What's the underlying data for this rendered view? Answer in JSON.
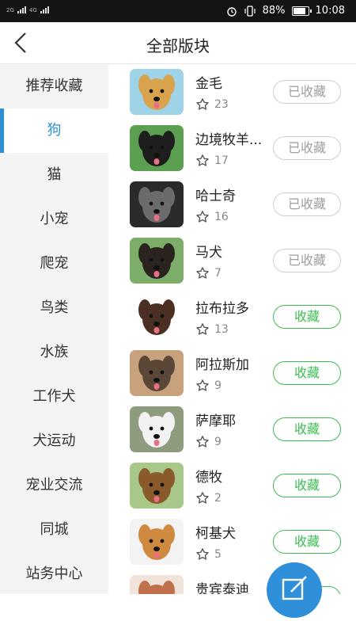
{
  "status_bar": {
    "signal_left": "2G",
    "signal_right": "4G",
    "battery": "88%",
    "time": "10:08"
  },
  "header": {
    "title": "全部版块",
    "back_icon": "chevron-left-icon"
  },
  "sidebar": {
    "items": [
      {
        "label": "推荐收藏",
        "active": false
      },
      {
        "label": "狗",
        "active": true
      },
      {
        "label": "猫",
        "active": false
      },
      {
        "label": "小宠",
        "active": false
      },
      {
        "label": "爬宠",
        "active": false
      },
      {
        "label": "鸟类",
        "active": false
      },
      {
        "label": "水族",
        "active": false
      },
      {
        "label": "工作犬",
        "active": false
      },
      {
        "label": "犬运动",
        "active": false
      },
      {
        "label": "宠业交流",
        "active": false
      },
      {
        "label": "同城",
        "active": false
      },
      {
        "label": "站务中心",
        "active": false
      }
    ]
  },
  "boards": [
    {
      "name": "金毛",
      "count": "23",
      "button": "已收藏",
      "collected": true,
      "fur": "#d9a24c",
      "bg": "#9fd3e8"
    },
    {
      "name": "边境牧羊...",
      "count": "17",
      "button": "已收藏",
      "collected": true,
      "fur": "#1e1e1e",
      "bg": "#5aa050"
    },
    {
      "name": "哈士奇",
      "count": "16",
      "button": "已收藏",
      "collected": true,
      "fur": "#6b6b6b",
      "bg": "#2a2a2a"
    },
    {
      "name": "马犬",
      "count": "7",
      "button": "已收藏",
      "collected": true,
      "fur": "#2b241e",
      "bg": "#7cae6a"
    },
    {
      "name": "拉布拉多",
      "count": "13",
      "button": "收藏",
      "collected": false,
      "fur": "#4a2f22",
      "bg": "#ffffff"
    },
    {
      "name": "阿拉斯加",
      "count": "9",
      "button": "收藏",
      "collected": false,
      "fur": "#5a4738",
      "bg": "#c8a27c"
    },
    {
      "name": "萨摩耶",
      "count": "9",
      "button": "收藏",
      "collected": false,
      "fur": "#f2f2f2",
      "bg": "#8f9b7d"
    },
    {
      "name": "德牧",
      "count": "2",
      "button": "收藏",
      "collected": false,
      "fur": "#8a5a2b",
      "bg": "#a8c88a"
    },
    {
      "name": "柯基犬",
      "count": "5",
      "button": "收藏",
      "collected": false,
      "fur": "#d08a3f",
      "bg": "#f3f3f3"
    },
    {
      "name": "贵宾泰迪",
      "count": "",
      "button": "收藏",
      "collected": false,
      "fur": "#c0704a",
      "bg": "#f0e4da"
    }
  ],
  "colors": {
    "accent": "#2f8fd8",
    "collect_green": "#3cbd50",
    "collected_gray": "#9e9e9e"
  },
  "fab": {
    "icon": "compose-icon"
  }
}
